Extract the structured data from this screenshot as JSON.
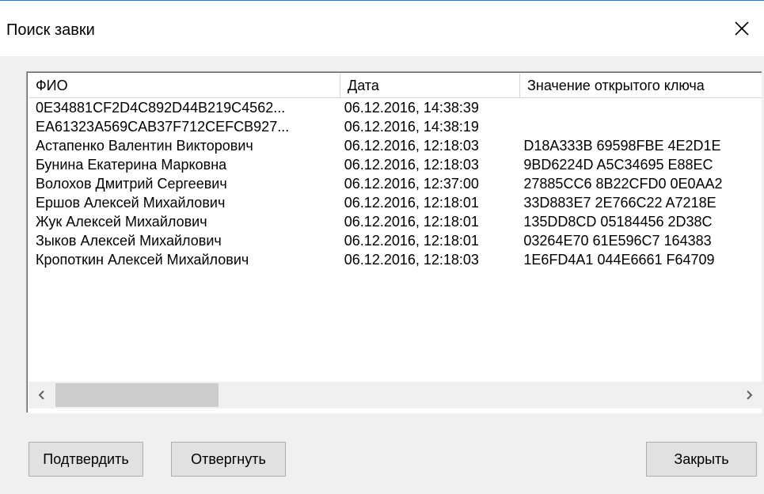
{
  "window": {
    "title": "Поиск завки",
    "close_icon": "close-icon"
  },
  "listview": {
    "columns": [
      "ФИО",
      "Дата",
      "Значение открытого ключа"
    ],
    "rows": [
      {
        "fio": "0E34881CF2D4C892D44B219C4562...",
        "date": "06.12.2016, 14:38:39",
        "key": ""
      },
      {
        "fio": "EA61323A569CAB37F712CEFCB927...",
        "date": "06.12.2016, 14:38:19",
        "key": ""
      },
      {
        "fio": "Астапенко Валентин Викторович",
        "date": "06.12.2016, 12:18:03",
        "key": "D18A333B 69598FBE 4E2D1E"
      },
      {
        "fio": "Бунина Екатерина Марковна",
        "date": "06.12.2016, 12:18:03",
        "key": "9BD6224D A5C34695 E88EC"
      },
      {
        "fio": "Волохов Дмитрий Сергеевич",
        "date": "06.12.2016, 12:37:00",
        "key": "27885CC6 8B22CFD0 0E0AA2"
      },
      {
        "fio": "Ершов Алексей Михайлович",
        "date": "06.12.2016, 12:18:01",
        "key": "33D883E7 2E766C22 A7218E"
      },
      {
        "fio": "Жук Алексей Михайлович",
        "date": "06.12.2016, 12:18:01",
        "key": "135DD8CD 05184456 2D38C"
      },
      {
        "fio": "Зыков Алексей Михайлович",
        "date": "06.12.2016, 12:18:01",
        "key": "03264E70 61E596C7 164383"
      },
      {
        "fio": "Кропоткин Алексей Михайлович",
        "date": "06.12.2016, 12:18:03",
        "key": "1E6FD4A1 044E6661 F64709"
      }
    ],
    "scrollbar": {
      "left_icon": "chevron-left-icon",
      "right_icon": "chevron-right-icon",
      "position": 0
    }
  },
  "buttons": {
    "confirm": "Подтвердить",
    "reject": "Отвергнуть",
    "close": "Закрыть"
  },
  "colors": {
    "window_border": "#2b79d0",
    "background": "#f0f0f0",
    "list_background": "#ffffff",
    "button_face": "#e1e1e1"
  }
}
